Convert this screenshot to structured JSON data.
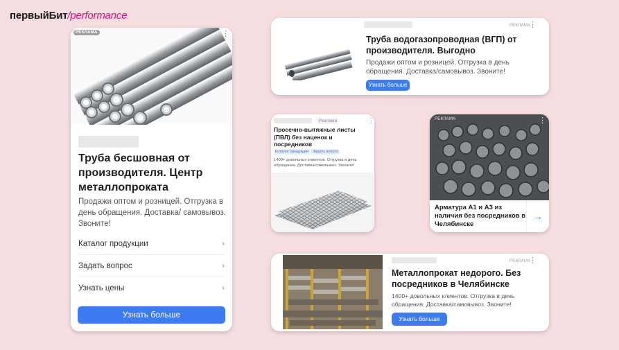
{
  "logo": {
    "part1": "первый",
    "part2": "Бит",
    "part3": "/performance"
  },
  "card_big": {
    "ad_label": "РЕКЛАМА",
    "title": "Труба бесшовная от производителя. Центр металлопроката",
    "description": "Продажи оптом и розницей. Отгрузка в день обращения. Доставка/ самовывоз. Звоните!",
    "links": [
      "Каталог продукции",
      "Задать вопрос",
      "Узнать цены"
    ],
    "button": "Узнать больше"
  },
  "card_vgp": {
    "ad_label": "РЕКЛАМА",
    "title": "Труба водогазопроводная (ВГП) от производителя. Выгодно",
    "description": "Продажи оптом и розницей. Отгрузка в день обращения. Доставка/самовывоз. Звоните!",
    "button": "Узнать больше"
  },
  "card_pvl": {
    "ad_label": "Реклама",
    "title": "Просечно-вытяжные листы (ПВЛ) без наценок и посредников",
    "links": [
      "Каталог продукции",
      "Задать вопрос"
    ],
    "description": "1400+ довольных клиентов. Отгрузка в день обращения. Доставка/самовывоз. Звоните!"
  },
  "card_armatura": {
    "ad_label": "РЕКЛАМА",
    "title": "Арматура А1 и А3 из наличия без посредников в Челябинске"
  },
  "card_metal": {
    "ad_label": "РЕКЛАМА",
    "title": "Металлопрокат недорого. Без посредников в Челябинске",
    "description": "1400+ довольных клиентов. Отгрузка в день обращения. Доставка/самовывоз. Звоните!",
    "button": "Узнать больше"
  },
  "icons": {
    "more": "more-vert-icon",
    "chevron": "chevron-right-icon",
    "arrow": "arrow-right-icon"
  },
  "colors": {
    "background": "#f6dde0",
    "accent": "#3d7bf0",
    "brand": "#d4147a"
  }
}
